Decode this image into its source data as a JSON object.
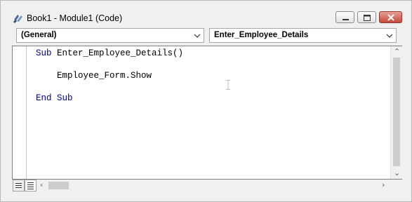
{
  "window": {
    "title": "Book1 - Module1 (Code)",
    "icons": {
      "app": "vba-module-icon",
      "minimize": "minimize-icon",
      "maximize": "maximize-icon",
      "close": "close-icon"
    }
  },
  "combos": {
    "object": {
      "value": "(General)"
    },
    "procedure": {
      "value": "Enter_Employee_Details"
    }
  },
  "code": {
    "line1": {
      "keyword": "Sub",
      "rest": " Enter_Employee_Details()"
    },
    "line2": {
      "text": "    Employee_Form.Show"
    },
    "line3": {
      "keyword": "End Sub"
    }
  },
  "colors": {
    "keyword": "#00008b",
    "close_button": "#c9483a",
    "window_bg": "#f0f0f0"
  }
}
